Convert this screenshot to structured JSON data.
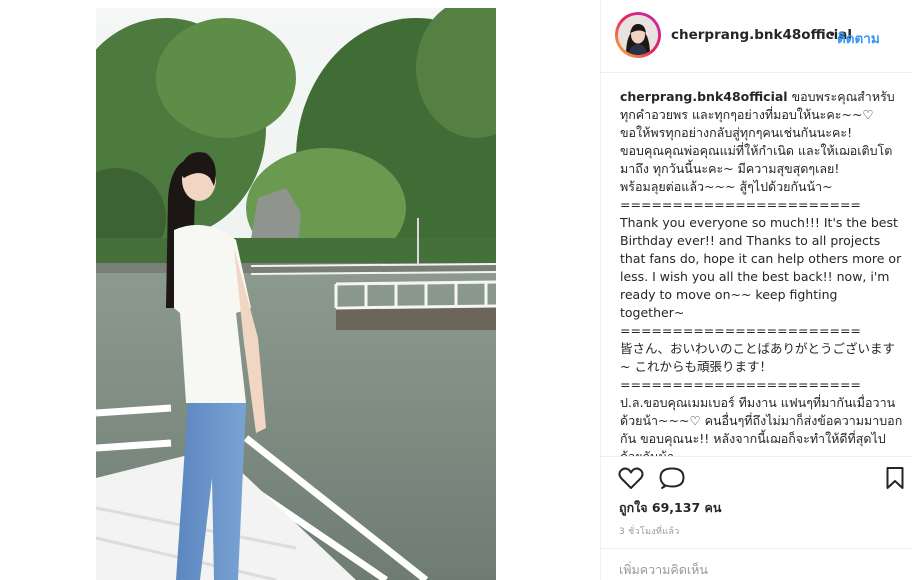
{
  "post": {
    "username": "cherprang.bnk48official",
    "separator": "•",
    "follow_label": "ติดตาม",
    "caption": {
      "username": "cherprang.bnk48official",
      "text": " ขอบพระคุณสำหรับทุกคำอวยพร และทุกๆอย่างที่มอบให้นะคะ~~♡\nขอให้พรทุกอย่างกลับสู่ทุกๆคนเช่นกันนะคะ!\nขอบคุณคุณพ่อคุณแม่ที่ให้กำเนิด และให้เฌอเติบโตมาถึง ทุกวันนี้นะคะ~ มีความสุขสุดๆเลย!\nพร้อมลุยต่อแล้ว~~~ สู้ๆไปด้วยกันน้า~\n=======================\nThank you everyone so much!!! It's the best Birthday ever!! and Thanks to all projects that fans do, hope it can help others more or less. I wish you all the best back!! now, i'm ready to move on~~ keep fighting together~\n=======================\n皆さん、おいわいのことばありがとうございます~ これからも頑張ります！\n=======================\nป.ล.ขอบคุณเมมเบอร์ ทีมงาน แฟนๆที่มากันเมื่อวานด้วยน้า~~~♡ คนอื่นๆที่ถึงไม่มาก็ส่งข้อความมาบอกกัน ขอบคุณนะ!! หลังจากนี้เฌอก็จะทำให้ดีที่สุดไปด้วยกันน้า~"
    },
    "likes_label": "ถูกใจ 69,137 คน",
    "timestamp": "3 ชั่วโมงที่แล้ว",
    "comment_placeholder": "เพิ่มความคิดเห็น"
  },
  "icons": {
    "like": "heart-icon",
    "comment": "comment-icon",
    "save": "bookmark-icon"
  },
  "colors": {
    "follow_blue": "#3897f0",
    "text": "#262626",
    "muted": "#999999",
    "border": "#efefef"
  }
}
